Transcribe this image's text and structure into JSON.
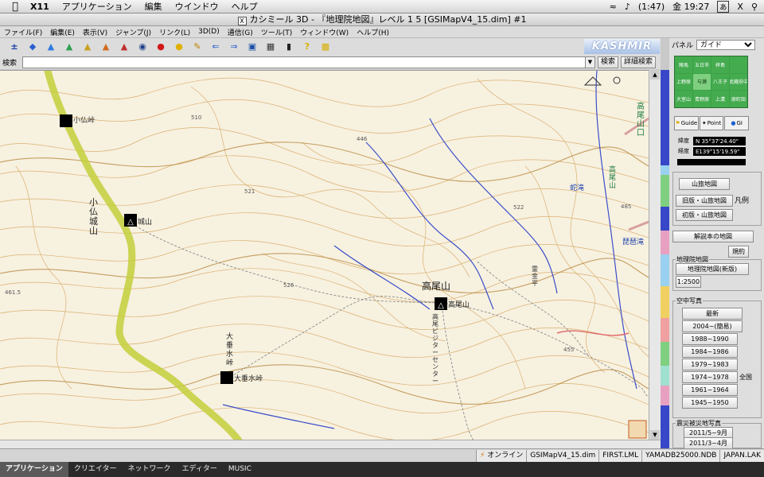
{
  "mac_menu": {
    "apple": "",
    "app_name": "X11",
    "items": [
      "アプリケーション",
      "編集",
      "ウインドウ",
      "ヘルプ"
    ],
    "battery": "(1:47)",
    "clock": "金 19:27",
    "input_mode": "あ"
  },
  "window": {
    "title": "カシミール 3D - 『地理院地図』レベル 1 5 [GSIMapV4_15.dim] #1"
  },
  "app_menu": [
    "ファイル(F)",
    "編集(E)",
    "表示(V)",
    "ジャンプ(J)",
    "リンク(L)",
    "3D(D)",
    "通信(G)",
    "ツール(T)",
    "ウィンドウ(W)",
    "ヘルプ(H)"
  ],
  "toolbar": {
    "icons": [
      "gps-icon",
      "layer-icon",
      "map-icon-1",
      "map-icon-2",
      "map-icon-3",
      "map-icon-4",
      "map-icon-5",
      "binoculars-icon",
      "marker-icon",
      "bubble-icon",
      "pencil-icon",
      "arrow-left-icon",
      "arrow-right-icon",
      "camera-icon",
      "film-icon",
      "device-icon",
      "help-icon",
      "walk-icon"
    ],
    "logo": "KASHMIR 3D"
  },
  "search": {
    "label": "検索",
    "value": "",
    "button": "検索",
    "detail_button": "詳細検索"
  },
  "map": {
    "labels": {
      "kobotoke_pass": "小仏峠",
      "shiroyama_vertical": "小仏城山",
      "shiroyama": "城山",
      "takao_big": "高尾山",
      "takao_small": "高尾山",
      "ohdarumi_vertical": "大垂水峠",
      "ohdarumi": "大垂水峠",
      "takao_station_vertical": "高尾山口",
      "kotaki": "蛇滝",
      "biwataki": "琵琶滝",
      "takao_right": "高尾山",
      "visitor_center": "高尾ビジターセンター",
      "path_label": "霊金平"
    },
    "elevations": [
      "510",
      "446",
      "521",
      "522",
      "485",
      "526",
      "455",
      "461.5"
    ]
  },
  "panel": {
    "label": "パネル",
    "select_value": "ガイド",
    "minimap": [
      "陣馬",
      "五日市",
      "拝島",
      "",
      "上野原",
      "与瀬",
      "八王子",
      "武蔵府中",
      "大室山",
      "青野原",
      "上溝",
      "原町田"
    ],
    "tabs": [
      "Guide",
      "Point",
      "GI"
    ],
    "lat_label": "緯度",
    "lat_value": "N 35°37'24.40\"",
    "lon_label": "経度",
    "lon_value": "E139°15'19.59\"",
    "sanzoku": [
      "山旅地図",
      "旧版・山旅地図",
      "初版・山旅地図"
    ],
    "hanrei": "凡例",
    "kaisetsu": "解説本の地図",
    "kiyaku": "規約",
    "chiriin_title": "地理院地図",
    "chiriin_btn": "地理院地図(新版)",
    "scale": "1:2500",
    "aerial_title": "空中写真",
    "aerial": [
      "最新",
      "2004~(簡易)",
      "1988~1990",
      "1984~1986",
      "1979~1983",
      "1974~1978",
      "1961~1964",
      "1945~1950"
    ],
    "aerial_all": "全国",
    "disaster_title": "震災被災地写真",
    "disaster": [
      "2011/5~9月",
      "2011/3~4月"
    ]
  },
  "status": {
    "online": "オンライン",
    "cells": [
      "GSIMapV4_15.dim",
      "FIRST.LML",
      "YAMADB25000.NDB",
      "JAPAN.LAK"
    ]
  },
  "dock": [
    "アプリケーション",
    "クリエイター",
    "ネットワーク",
    "エディター",
    "MUSIC"
  ],
  "colors": {
    "map_bg": "#f7f1e0",
    "contour": "#d6a65e",
    "trail": "#c4cf3a",
    "stream": "#3a4ec9",
    "panel_green": "#3aa146"
  }
}
